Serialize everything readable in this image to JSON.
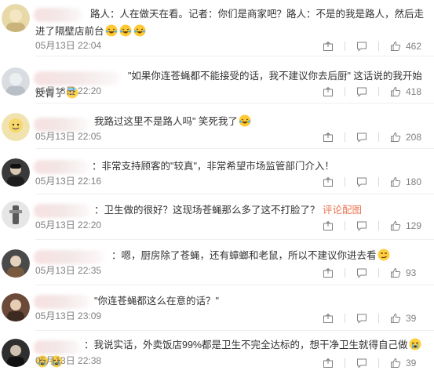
{
  "comments": [
    {
      "text": "路人：人在做天在看。记者：你们是商家吧？路人：不是的我是路人，然后走进了隔壁店前台",
      "time": "05月13日 22:04",
      "likes": "462",
      "avatar_color": "#e8d9a8",
      "emojis": [
        "laughing-crying-emoji",
        "laughing-crying-emoji",
        "laughing-crying-emoji"
      ]
    },
    {
      "text": "\"如果你连苍蝇都不能接受的话，我不建议你去后厨\" 这话说的我开始反胃了",
      "time": "05月13日 22:20",
      "likes": "418",
      "avatar_color": "#d9dde2",
      "emojis": [
        "nauseous-emoji"
      ]
    },
    {
      "text": "我路过这里不是路人吗\" 笑死我了",
      "time": "05月13日 22:05",
      "likes": "208",
      "avatar_color": "#f1e3b0",
      "emojis": [
        "laughing-crying-emoji"
      ]
    },
    {
      "text": "：非常支持顾客的\"较真\"，非常希望市场监管部门介入！",
      "time": "05月13日 22:16",
      "likes": "180",
      "avatar_color": "#3a3a3a",
      "emojis": []
    },
    {
      "text": "：卫生做的很好？这现场苍蝇那么多了这不打脸了？",
      "link": "评论配图",
      "time": "05月13日 22:20",
      "likes": "129",
      "avatar_color": "#e6e6e6",
      "emojis": []
    },
    {
      "text": "：嗯，厨房除了苍蝇，还有蟑螂和老鼠，所以不建议你进去看",
      "time": "05月13日 22:35",
      "likes": "93",
      "avatar_color": "#4a4a4a",
      "emojis": [
        "smirk-emoji"
      ]
    },
    {
      "text": "\"你连苍蝇都这么在意的话？\"",
      "time": "05月13日 23:09",
      "likes": "39",
      "avatar_color": "#6b4a3a",
      "emojis": []
    },
    {
      "text": "：我说实话，外卖饭店99%都是卫生不完全达标的，想干净卫生就得自己做",
      "time": "05月13日 22:38",
      "likes": "39",
      "avatar_color": "#2f2f2f",
      "emojis": [
        "crying-emoji",
        "crying-emoji",
        "crying-emoji"
      ]
    }
  ],
  "colors": {
    "link": "#eb7350",
    "meta": "#808080",
    "text": "#333333"
  }
}
